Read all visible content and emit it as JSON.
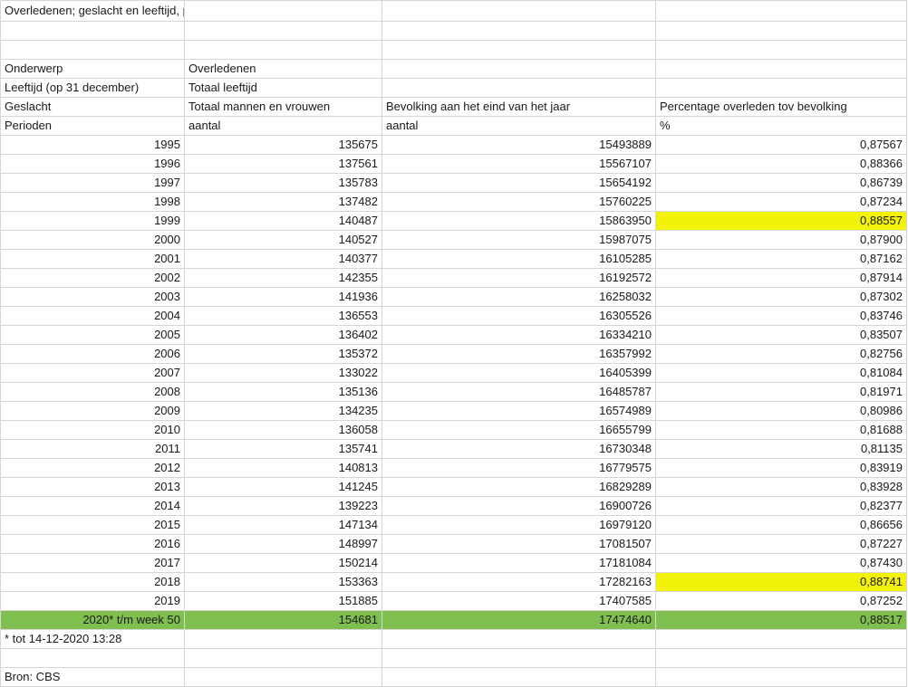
{
  "title": "Overledenen; geslacht en leeftijd, per week",
  "header": [
    [
      "Onderwerp",
      "Overledenen",
      "",
      ""
    ],
    [
      "Leeftijd (op 31 december)",
      "Totaal leeftijd",
      "",
      ""
    ],
    [
      "Geslacht",
      "Totaal mannen en vrouwen",
      "Bevolking aan het eind van het jaar",
      "Percentage overleden tov bevolking"
    ],
    [
      "Perioden",
      "aantal",
      "aantal",
      "%"
    ]
  ],
  "rows": [
    {
      "period": "1995",
      "deaths": "135675",
      "population": "15493889",
      "pct": "0,87567"
    },
    {
      "period": "1996",
      "deaths": "137561",
      "population": "15567107",
      "pct": "0,88366"
    },
    {
      "period": "1997",
      "deaths": "135783",
      "population": "15654192",
      "pct": "0,86739"
    },
    {
      "period": "1998",
      "deaths": "137482",
      "population": "15760225",
      "pct": "0,87234"
    },
    {
      "period": "1999",
      "deaths": "140487",
      "population": "15863950",
      "pct": "0,88557"
    },
    {
      "period": "2000",
      "deaths": "140527",
      "population": "15987075",
      "pct": "0,87900"
    },
    {
      "period": "2001",
      "deaths": "140377",
      "population": "16105285",
      "pct": "0,87162"
    },
    {
      "period": "2002",
      "deaths": "142355",
      "population": "16192572",
      "pct": "0,87914"
    },
    {
      "period": "2003",
      "deaths": "141936",
      "population": "16258032",
      "pct": "0,87302"
    },
    {
      "period": "2004",
      "deaths": "136553",
      "population": "16305526",
      "pct": "0,83746"
    },
    {
      "period": "2005",
      "deaths": "136402",
      "population": "16334210",
      "pct": "0,83507"
    },
    {
      "period": "2006",
      "deaths": "135372",
      "population": "16357992",
      "pct": "0,82756"
    },
    {
      "period": "2007",
      "deaths": "133022",
      "population": "16405399",
      "pct": "0,81084"
    },
    {
      "period": "2008",
      "deaths": "135136",
      "population": "16485787",
      "pct": "0,81971"
    },
    {
      "period": "2009",
      "deaths": "134235",
      "population": "16574989",
      "pct": "0,80986"
    },
    {
      "period": "2010",
      "deaths": "136058",
      "population": "16655799",
      "pct": "0,81688"
    },
    {
      "period": "2011",
      "deaths": "135741",
      "population": "16730348",
      "pct": "0,81135"
    },
    {
      "period": "2012",
      "deaths": "140813",
      "population": "16779575",
      "pct": "0,83919"
    },
    {
      "period": "2013",
      "deaths": "141245",
      "population": "16829289",
      "pct": "0,83928"
    },
    {
      "period": "2014",
      "deaths": "139223",
      "population": "16900726",
      "pct": "0,82377"
    },
    {
      "period": "2015",
      "deaths": "147134",
      "population": "16979120",
      "pct": "0,86656"
    },
    {
      "period": "2016",
      "deaths": "148997",
      "population": "17081507",
      "pct": "0,87227"
    },
    {
      "period": "2017",
      "deaths": "150214",
      "population": "17181084",
      "pct": "0,87430"
    },
    {
      "period": "2018",
      "deaths": "153363",
      "population": "17282163",
      "pct": "0,88741"
    },
    {
      "period": "2019",
      "deaths": "151885",
      "population": "17407585",
      "pct": "0,87252"
    },
    {
      "period": "2020* t/m week 50",
      "deaths": "154681",
      "population": "17474640",
      "pct": "0,88517"
    }
  ],
  "highlight_yellow_periods": [
    "1999",
    "2018"
  ],
  "highlight_green_period": "2020* t/m week 50",
  "colors": {
    "yellow_highlight": "#f2f20a",
    "green_highlight": "#7fbf4f",
    "grid": "#d6d6d6"
  },
  "footnote": "* tot 14-12-2020 13:28",
  "source": "Bron: CBS"
}
